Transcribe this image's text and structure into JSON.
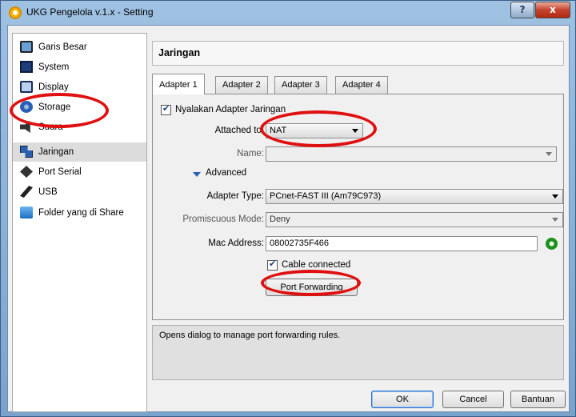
{
  "window": {
    "title": "UKG Pengelola v.1.x - Setting",
    "help_label": "?",
    "close_label": "x"
  },
  "sidebar": {
    "items": [
      {
        "label": "Garis Besar",
        "icon": "monitor-icon"
      },
      {
        "label": "System",
        "icon": "chip-icon"
      },
      {
        "label": "Display",
        "icon": "display-icon"
      },
      {
        "label": "Storage",
        "icon": "disk-icon"
      },
      {
        "label": "Suara",
        "icon": "speaker-icon"
      },
      {
        "label": "Jaringan",
        "icon": "network-icon",
        "selected": true
      },
      {
        "label": "Port Serial",
        "icon": "serial-port-icon"
      },
      {
        "label": "USB",
        "icon": "usb-icon"
      },
      {
        "label": "Folder yang di Share",
        "icon": "folder-icon"
      }
    ]
  },
  "header": {
    "title": "Jaringan"
  },
  "tabs": [
    {
      "label": "Adapter 1",
      "active": true
    },
    {
      "label": "Adapter 2"
    },
    {
      "label": "Adapter 3"
    },
    {
      "label": "Adapter 4"
    }
  ],
  "adapter": {
    "enable_label": "Nyalakan Adapter Jaringan",
    "enable_checked": true,
    "attached_label": "Attached to:",
    "attached_value": "NAT",
    "name_label": "Name:",
    "name_value": "",
    "advanced_label": "Advanced",
    "adapter_type_label": "Adapter Type:",
    "adapter_type_value": "PCnet-FAST III (Am79C973)",
    "promiscuous_label": "Promiscuous Mode:",
    "promiscuous_value": "Deny",
    "mac_label": "Mac Address:",
    "mac_value": "08002735F466",
    "cable_label": "Cable connected",
    "cable_checked": true,
    "port_forwarding_label": "Port Forwarding"
  },
  "status": {
    "text": "Opens dialog to manage port forwarding rules."
  },
  "footer": {
    "ok_label": "OK",
    "cancel_label": "Cancel",
    "help_label": "Bantuan"
  },
  "colors": {
    "highlight_ellipse": "#e01010",
    "accent": "#2d6fd0"
  }
}
